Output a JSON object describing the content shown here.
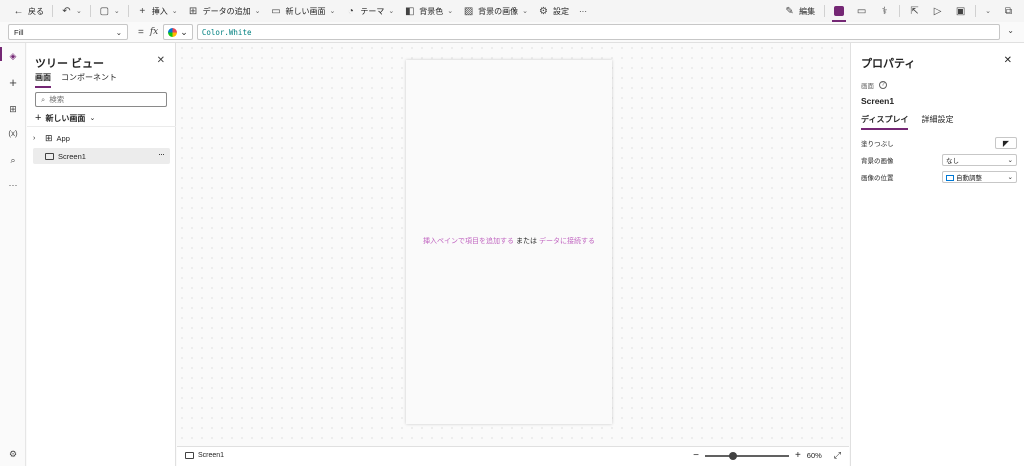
{
  "toolbar": {
    "back": "戻る",
    "insert": "挿入",
    "add_data": "データの追加",
    "new_screen": "新しい画面",
    "theme": "テーマ",
    "background_color": "背景色",
    "background_image": "背景の画像",
    "settings": "設定",
    "more": "···",
    "edit": "編集"
  },
  "formula_bar": {
    "property": "Fill",
    "equals": "=",
    "fx": "fx",
    "formula": "Color.White"
  },
  "tree_view": {
    "title": "ツリー ビュー",
    "tabs": [
      "画面",
      "コンポーネント"
    ],
    "search_placeholder": "検索",
    "new_screen": "新しい画面",
    "nodes": [
      {
        "label": "App"
      },
      {
        "label": "Screen1"
      }
    ],
    "more": "···"
  },
  "canvas": {
    "hint_part1": "挿入ペインで項目を追加する",
    "hint_part2": "または",
    "hint_part3": "データに接続する",
    "screen_label": "Screen1",
    "zoom": "60%",
    "zoom_fraction": 0.33
  },
  "properties": {
    "title": "プロパティ",
    "kind": "画面",
    "name": "Screen1",
    "tabs": [
      "ディスプレイ",
      "詳細設定"
    ],
    "rows": {
      "fill_label": "塗りつぶし",
      "bg_image_label": "背景の画像",
      "bg_image_value": "なし",
      "image_position_label": "画像の位置",
      "image_position_value": "自動調整"
    }
  },
  "colors": {
    "accent": "#742774",
    "link": "#c064c0",
    "formula_text": "#008080"
  }
}
